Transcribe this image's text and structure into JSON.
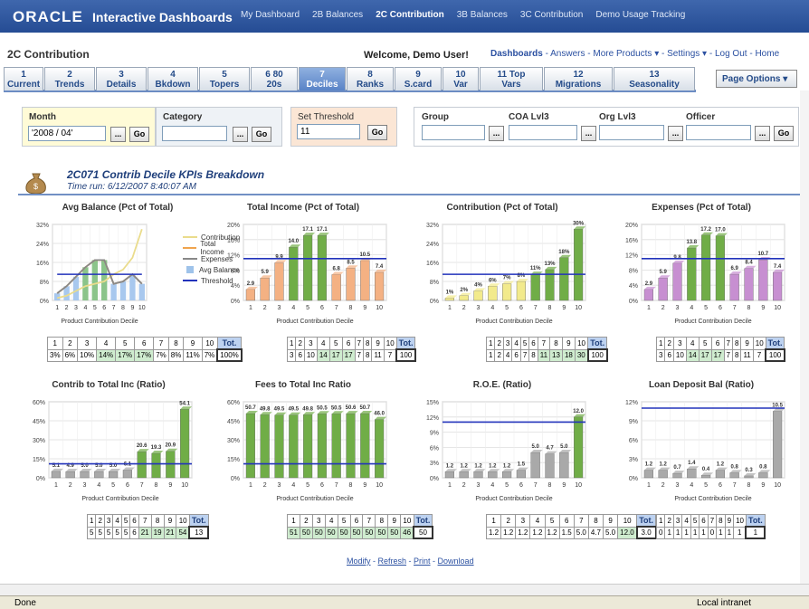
{
  "header": {
    "logo": "ORACLE",
    "app_title": "Interactive Dashboards",
    "nav": [
      "My Dashboard",
      "2B Balances",
      "2C Contribution",
      "3B Balances",
      "3C Contribution",
      "Demo Usage Tracking"
    ],
    "active_nav": "2C Contribution"
  },
  "subheader": {
    "page_title": "2C Contribution",
    "welcome": "Welcome, Demo User!",
    "links": {
      "dashboards": "Dashboards",
      "answers": "Answers",
      "more_products": "More Products",
      "settings": "Settings",
      "logout": "Log Out",
      "home": "Home"
    }
  },
  "tabs": [
    {
      "l1": "1",
      "l2": "Current"
    },
    {
      "l1": "2",
      "l2": "Trends"
    },
    {
      "l1": "3",
      "l2": "Details"
    },
    {
      "l1": "4",
      "l2": "Bkdown"
    },
    {
      "l1": "5",
      "l2": "Topers"
    },
    {
      "l1": "6 80",
      "l2": "20s"
    },
    {
      "l1": "7",
      "l2": "Deciles"
    },
    {
      "l1": "8",
      "l2": "Ranks"
    },
    {
      "l1": "9",
      "l2": "S.card"
    },
    {
      "l1": "10",
      "l2": "Var"
    },
    {
      "l1": "11 Top",
      "l2": "Vars"
    },
    {
      "l1": "12",
      "l2": "Migrations"
    },
    {
      "l1": "13",
      "l2": "Seasonality"
    }
  ],
  "page_options": "Page Options",
  "prompts": {
    "month_label": "Month",
    "month_value": "'2008 / 04'",
    "category_label": "Category",
    "threshold_label": "Set Threshold",
    "threshold_value": "11",
    "group_label": "Group",
    "coa_label": "COA Lvl3",
    "org_label": "Org Lvl3",
    "officer_label": "Officer",
    "go": "Go",
    "browse": "..."
  },
  "section": {
    "title": "2C071 Contrib Decile KPIs Breakdown",
    "time_run": "Time run: 6/12/2007 8:40:07 AM"
  },
  "colors": {
    "bar_gray": "#a9a9a9",
    "bar_orange": "#f4b183",
    "bar_green": "#70ad47",
    "bar_yellow": "#f5f1a0",
    "bar_purple": "#c78fd1",
    "bar_blue": "#a8c8ee",
    "threshold": "#2233bb",
    "brand": "#2a55a3"
  },
  "decile_axis_label": "Product Contribution Decile",
  "chart_data": [
    {
      "type": "line",
      "title": "Avg Balance (Pct of Total)",
      "xlabel": "Product Contribution Decile",
      "x": [
        1,
        2,
        3,
        4,
        5,
        6,
        7,
        8,
        9,
        10
      ],
      "yticks": [
        "0%",
        "8%",
        "16%",
        "24%",
        "32%"
      ],
      "ylim": [
        0,
        32
      ],
      "series": [
        {
          "name": "Contribution",
          "values": [
            1,
            2,
            4,
            6,
            7,
            8,
            11,
            13,
            18,
            30
          ]
        },
        {
          "name": "Total Income",
          "values": [
            3,
            6,
            10,
            14,
            17,
            17,
            7,
            8,
            11,
            7
          ]
        },
        {
          "name": "Expenses",
          "values": [
            3,
            6,
            10,
            14,
            17,
            17,
            7,
            8,
            11,
            7
          ]
        },
        {
          "name": "Avg Balance",
          "values": [
            3,
            6,
            10,
            14,
            17,
            17,
            7,
            8,
            11,
            7
          ]
        },
        {
          "name": "Threshold",
          "values": [
            11,
            11,
            11,
            11,
            11,
            11,
            11,
            11,
            11,
            11
          ]
        }
      ],
      "legend": "right",
      "table_values": [
        "3%",
        "6%",
        "10%",
        "14%",
        "17%",
        "17%",
        "7%",
        "8%",
        "11%",
        "7%",
        "100%"
      ],
      "table_hl": [
        3,
        4,
        5
      ]
    },
    {
      "type": "bar",
      "title": "Total Income (Pct of Total)",
      "xlabel": "Product Contribution Decile",
      "categories": [
        1,
        2,
        3,
        4,
        5,
        6,
        7,
        8,
        9,
        10
      ],
      "values": [
        2.9,
        5.9,
        9.9,
        14.0,
        17.1,
        17.1,
        6.8,
        8.5,
        10.5,
        7.4
      ],
      "labels": [
        "2.9",
        "5.9",
        "9.9",
        "14.0",
        "17.1",
        "17.1",
        "6.8",
        "8.5",
        "10.5",
        "7.4"
      ],
      "yticks": [
        "0%",
        "4%",
        "8%",
        "12%",
        "16%",
        "20%"
      ],
      "ylim": [
        0,
        20
      ],
      "threshold": 11,
      "table_values": [
        "3",
        "6",
        "10",
        "14",
        "17",
        "17",
        "7",
        "8",
        "11",
        "7",
        "100"
      ],
      "table_hl": [
        3,
        4,
        5
      ]
    },
    {
      "type": "bar",
      "title": "Contribution (Pct of Total)",
      "xlabel": "Product Contribution Decile",
      "categories": [
        1,
        2,
        3,
        4,
        5,
        6,
        7,
        8,
        9,
        10
      ],
      "values": [
        1,
        2,
        4,
        6,
        7,
        8,
        11,
        13,
        18,
        30
      ],
      "labels": [
        "1%",
        "2%",
        "4%",
        "6%",
        "7%",
        "8%",
        "11%",
        "13%",
        "18%",
        "30%"
      ],
      "yticks": [
        "0%",
        "8%",
        "16%",
        "24%",
        "32%"
      ],
      "ylim": [
        0,
        32
      ],
      "threshold": 11,
      "table_values": [
        "1",
        "2",
        "4",
        "6",
        "7",
        "8",
        "11",
        "13",
        "18",
        "30",
        "100"
      ],
      "table_hl": [
        6,
        7,
        8,
        9
      ]
    },
    {
      "type": "bar",
      "title": "Expenses  (Pct of Total)",
      "xlabel": "Product Contribution Decile",
      "categories": [
        1,
        2,
        3,
        4,
        5,
        6,
        7,
        8,
        9,
        10
      ],
      "values": [
        2.9,
        5.9,
        9.8,
        13.8,
        17.2,
        17.0,
        6.9,
        8.4,
        10.7,
        7.4
      ],
      "labels": [
        "2.9",
        "5.9",
        "9.8",
        "13.8",
        "17.2",
        "17.0",
        "6.9",
        "8.4",
        "10.7",
        "7.4"
      ],
      "yticks": [
        "0%",
        "4%",
        "8%",
        "12%",
        "16%",
        "20%"
      ],
      "ylim": [
        0,
        20
      ],
      "threshold": 11,
      "table_values": [
        "3",
        "6",
        "10",
        "14",
        "17",
        "17",
        "7",
        "8",
        "11",
        "7",
        "100"
      ],
      "table_hl": [
        3,
        4,
        5
      ]
    },
    {
      "type": "bar",
      "title": "Contrib to Total Inc (Ratio)",
      "xlabel": "Product Contribution Decile",
      "categories": [
        1,
        2,
        3,
        4,
        5,
        6,
        7,
        8,
        9,
        10
      ],
      "values": [
        5.1,
        4.9,
        5.0,
        5.0,
        5.0,
        6.1,
        20.6,
        19.3,
        20.9,
        54.1
      ],
      "labels": [
        "5.1",
        "4.9",
        "5.0",
        "5.0",
        "5.0",
        "6.1",
        "20.6",
        "19.3",
        "20.9",
        "54.1"
      ],
      "yticks": [
        "0%",
        "15%",
        "30%",
        "45%",
        "60%"
      ],
      "ylim": [
        0,
        60
      ],
      "threshold": 11,
      "table_values": [
        "5",
        "5",
        "5",
        "5",
        "5",
        "6",
        "21",
        "19",
        "21",
        "54",
        "13"
      ],
      "table_hl": [
        6,
        7,
        8,
        9
      ]
    },
    {
      "type": "bar",
      "title": "Fees to Total Inc Ratio",
      "xlabel": "Product Contribution Decile",
      "categories": [
        1,
        2,
        3,
        4,
        5,
        6,
        7,
        8,
        9,
        10
      ],
      "values": [
        50.7,
        49.8,
        49.5,
        49.5,
        49.8,
        50.5,
        50.5,
        50.6,
        50.7,
        46.0
      ],
      "labels": [
        "50.7",
        "49.8",
        "49.5",
        "49.5",
        "49.8",
        "50.5",
        "50.5",
        "50.6",
        "50.7",
        "46.0"
      ],
      "yticks": [
        "0%",
        "15%",
        "30%",
        "45%",
        "60%"
      ],
      "ylim": [
        0,
        60
      ],
      "threshold": 11,
      "table_values": [
        "51",
        "50",
        "50",
        "50",
        "50",
        "50",
        "50",
        "50",
        "50",
        "46",
        "50"
      ],
      "table_hl": [
        0,
        1,
        2,
        3,
        4,
        5,
        6,
        7,
        8,
        9
      ]
    },
    {
      "type": "bar",
      "title": "R.O.E. (Ratio)",
      "xlabel": "Product Contribution Decile",
      "categories": [
        1,
        2,
        3,
        4,
        5,
        6,
        7,
        8,
        9,
        10
      ],
      "values": [
        1.2,
        1.2,
        1.2,
        1.2,
        1.2,
        1.5,
        5.0,
        4.7,
        5.0,
        12.0
      ],
      "labels": [
        "1.2",
        "1.2",
        "1.2",
        "1.2",
        "1.2",
        "1.5",
        "5.0",
        "4.7",
        "5.0",
        "12.0"
      ],
      "yticks": [
        "0%",
        "3%",
        "6%",
        "9%",
        "12%",
        "15%"
      ],
      "ylim": [
        0,
        15
      ],
      "threshold": 11,
      "table_values": [
        "1.2",
        "1.2",
        "1.2",
        "1.2",
        "1.2",
        "1.5",
        "5.0",
        "4.7",
        "5.0",
        "12.0",
        "3.0"
      ],
      "table_hl": [
        9
      ]
    },
    {
      "type": "bar",
      "title": "Loan Deposit Bal (Ratio)",
      "xlabel": "Product Contribution Decile",
      "categories": [
        1,
        2,
        3,
        4,
        5,
        6,
        7,
        8,
        9,
        10
      ],
      "values": [
        1.2,
        1.2,
        0.7,
        1.4,
        0.4,
        1.2,
        0.8,
        0.3,
        0.8,
        10.5
      ],
      "labels": [
        "1.2",
        "1.2",
        "0.7",
        "1.4",
        "0.4",
        "1.2",
        "0.8",
        "0.3",
        "0.8",
        "10.5"
      ],
      "yticks": [
        "0%",
        "3%",
        "6%",
        "9%",
        "12%"
      ],
      "ylim": [
        0,
        12
      ],
      "threshold": 11,
      "table_values": [
        "0",
        "1",
        "1",
        "1",
        "1",
        "1",
        "0",
        "1",
        "1",
        "1",
        "1"
      ],
      "table_hl": []
    }
  ],
  "actions": {
    "modify": "Modify",
    "refresh": "Refresh",
    "print": "Print",
    "download": "Download"
  },
  "status": {
    "done": "Done",
    "zone": "Local intranet"
  }
}
